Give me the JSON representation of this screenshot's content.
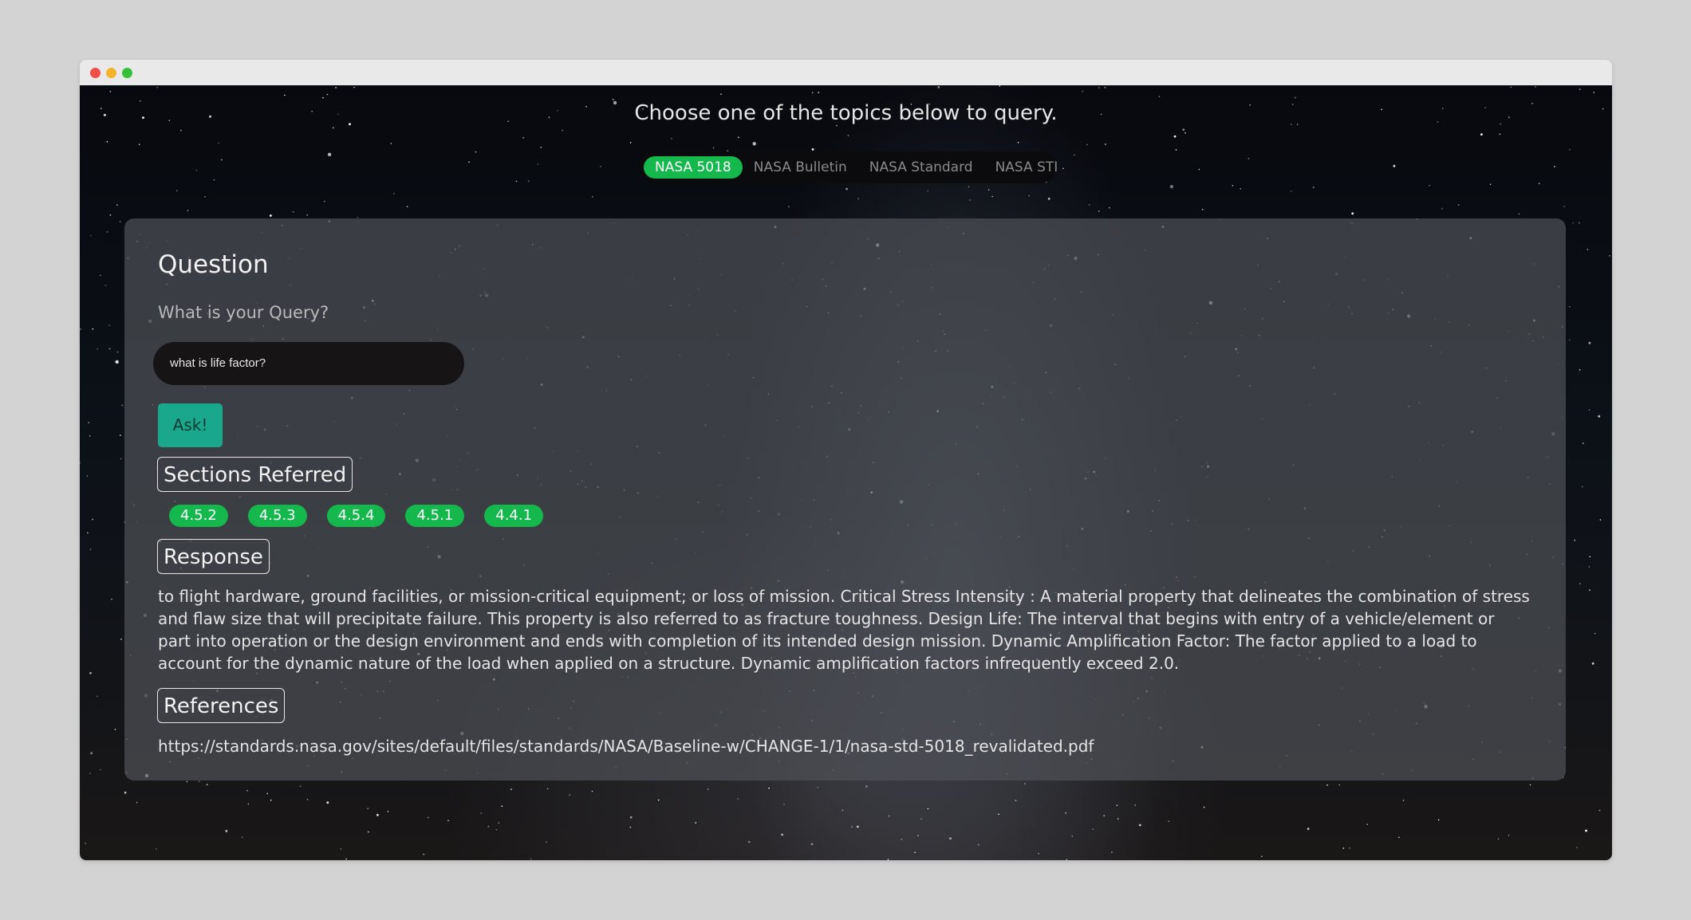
{
  "heading": "Choose one of the topics below to query.",
  "topics": [
    {
      "label": "NASA 5018",
      "active": true
    },
    {
      "label": "NASA Bulletin",
      "active": false
    },
    {
      "label": "NASA Standard",
      "active": false
    },
    {
      "label": "NASA STI",
      "active": false
    }
  ],
  "question": {
    "title": "Question",
    "label": "What is your Query?",
    "input_value": "what is life factor?",
    "ask_label": "Ask!"
  },
  "sections": {
    "title": "Sections Referred",
    "chips": [
      "4.5.2",
      "4.5.3",
      "4.5.4",
      "4.5.1",
      "4.4.1"
    ]
  },
  "response": {
    "title": "Response",
    "text": "to flight hardware, ground facilities, or mission-critical equipment; or loss of mission. Critical Stress Intensity : A material property that delineates the combination of stress and flaw size that will precipitate failure. This property is also referred to as fracture toughness. Design Life: The interval that begins with entry of a vehicle/element or part into operation or the design environment and ends with completion of its intended design mission. Dynamic Amplification Factor: The factor applied to a load to account for the dynamic nature of the load when applied on a structure. Dynamic amplification factors infrequently exceed 2.0."
  },
  "references": {
    "title": "References",
    "url": "https://standards.nasa.gov/sites/default/files/standards/NASA/Baseline-w/CHANGE-1/1/nasa-std-5018_revalidated.pdf"
  },
  "colors": {
    "accent_green": "#14b84c",
    "ask_teal": "#1aa88c",
    "card_bg": "#4e5056"
  }
}
